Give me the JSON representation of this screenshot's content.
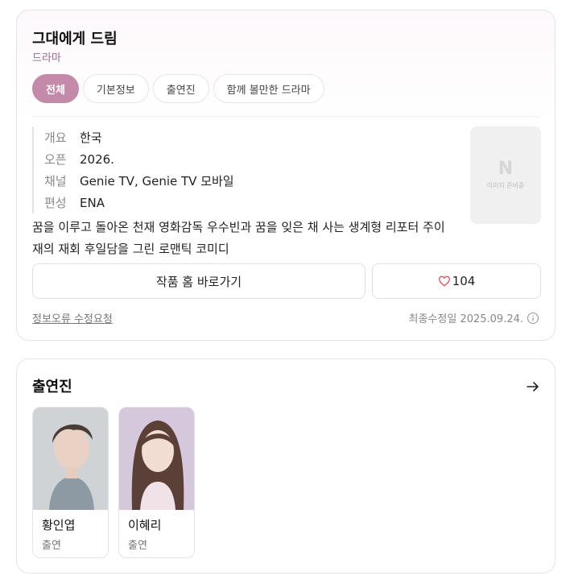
{
  "drama": {
    "title": "그대에게 드림",
    "genre": "드라마",
    "tabs": [
      "전체",
      "기본정보",
      "출연진",
      "함께 볼만한 드라마"
    ],
    "meta": [
      {
        "key": "개요",
        "value": "한국"
      },
      {
        "key": "오픈",
        "value": "2026."
      },
      {
        "key": "채널",
        "value": "Genie TV, Genie TV 모바일"
      },
      {
        "key": "편성",
        "value": "ENA"
      }
    ],
    "synopsis": "꿈을 이루고 돌아온 천재 영화감독 우수빈과 꿈을 잊은 채 사는 생계형 리포터 주이재의 재회 후일담을 그린 로맨틱 코미디",
    "poster": {
      "logo": "N",
      "placeholder": "이미지 준비중"
    },
    "home_button": "작품 홈 바로가기",
    "likes": "104",
    "report_link": "정보오류 수정요청",
    "updated": "최종수정일 2025.09.24."
  },
  "cast_section": {
    "title": "출연진",
    "members": [
      {
        "name": "황인엽",
        "role": "출연"
      },
      {
        "name": "이혜리",
        "role": "출연"
      }
    ]
  },
  "colors": {
    "accent": "#c48aa9",
    "genre": "#9a6a8c",
    "heart": "#e0525c"
  },
  "icons": [
    "heart-icon",
    "info-icon",
    "arrow-right-icon"
  ]
}
